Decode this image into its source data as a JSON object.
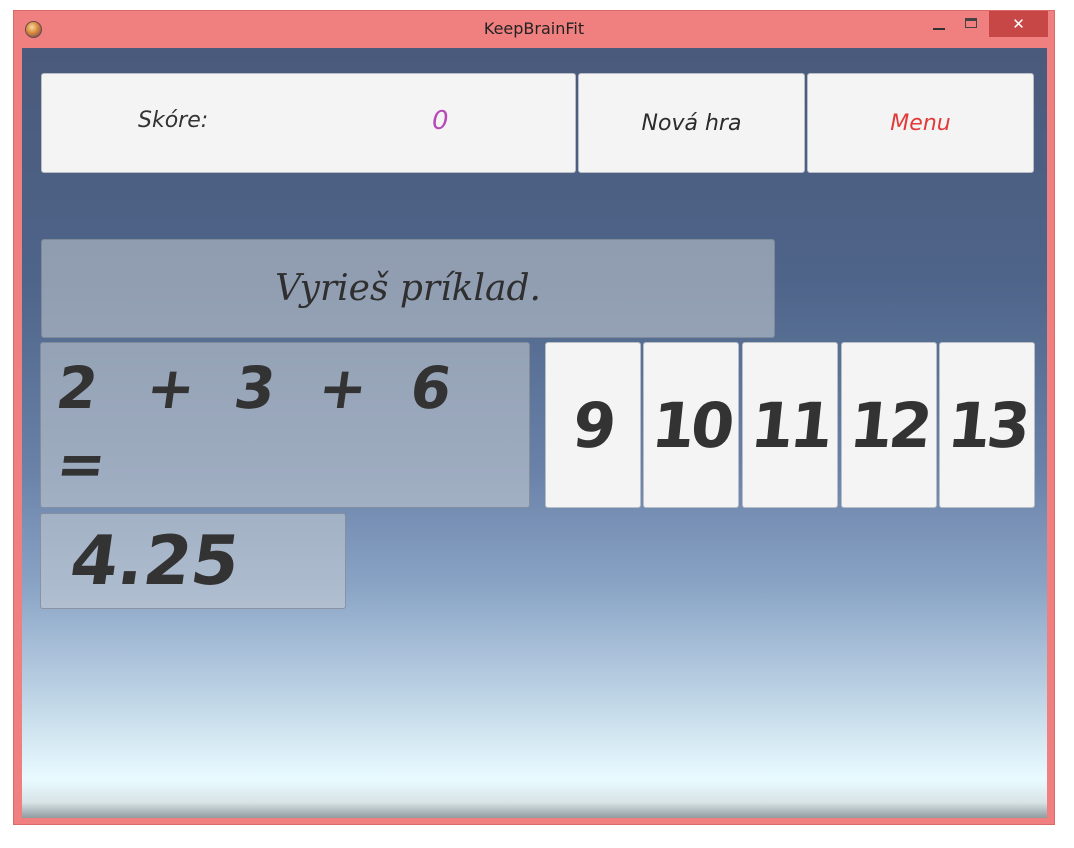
{
  "window": {
    "title": "KeepBrainFit",
    "close_label": "✕"
  },
  "header": {
    "score_label": "Skóre:",
    "score_value": "0",
    "new_game_label": "Nová hra",
    "menu_label": "Menu"
  },
  "instruction": "Vyrieš príklad.",
  "equation": {
    "tokens": [
      "2",
      "+",
      "3",
      "+",
      "6"
    ],
    "equals": "="
  },
  "answer": "4.25",
  "choices": [
    "9",
    "10",
    "11",
    "12",
    "13"
  ],
  "colors": {
    "window_frame": "#f08080",
    "close_button": "#c74646",
    "score_value": "#b54ab8",
    "menu_label": "#e23a3a",
    "text_dark": "#333333"
  },
  "icons": {
    "app": "app-icon",
    "minimize": "minimize-icon",
    "maximize": "maximize-icon",
    "close": "close-icon"
  }
}
